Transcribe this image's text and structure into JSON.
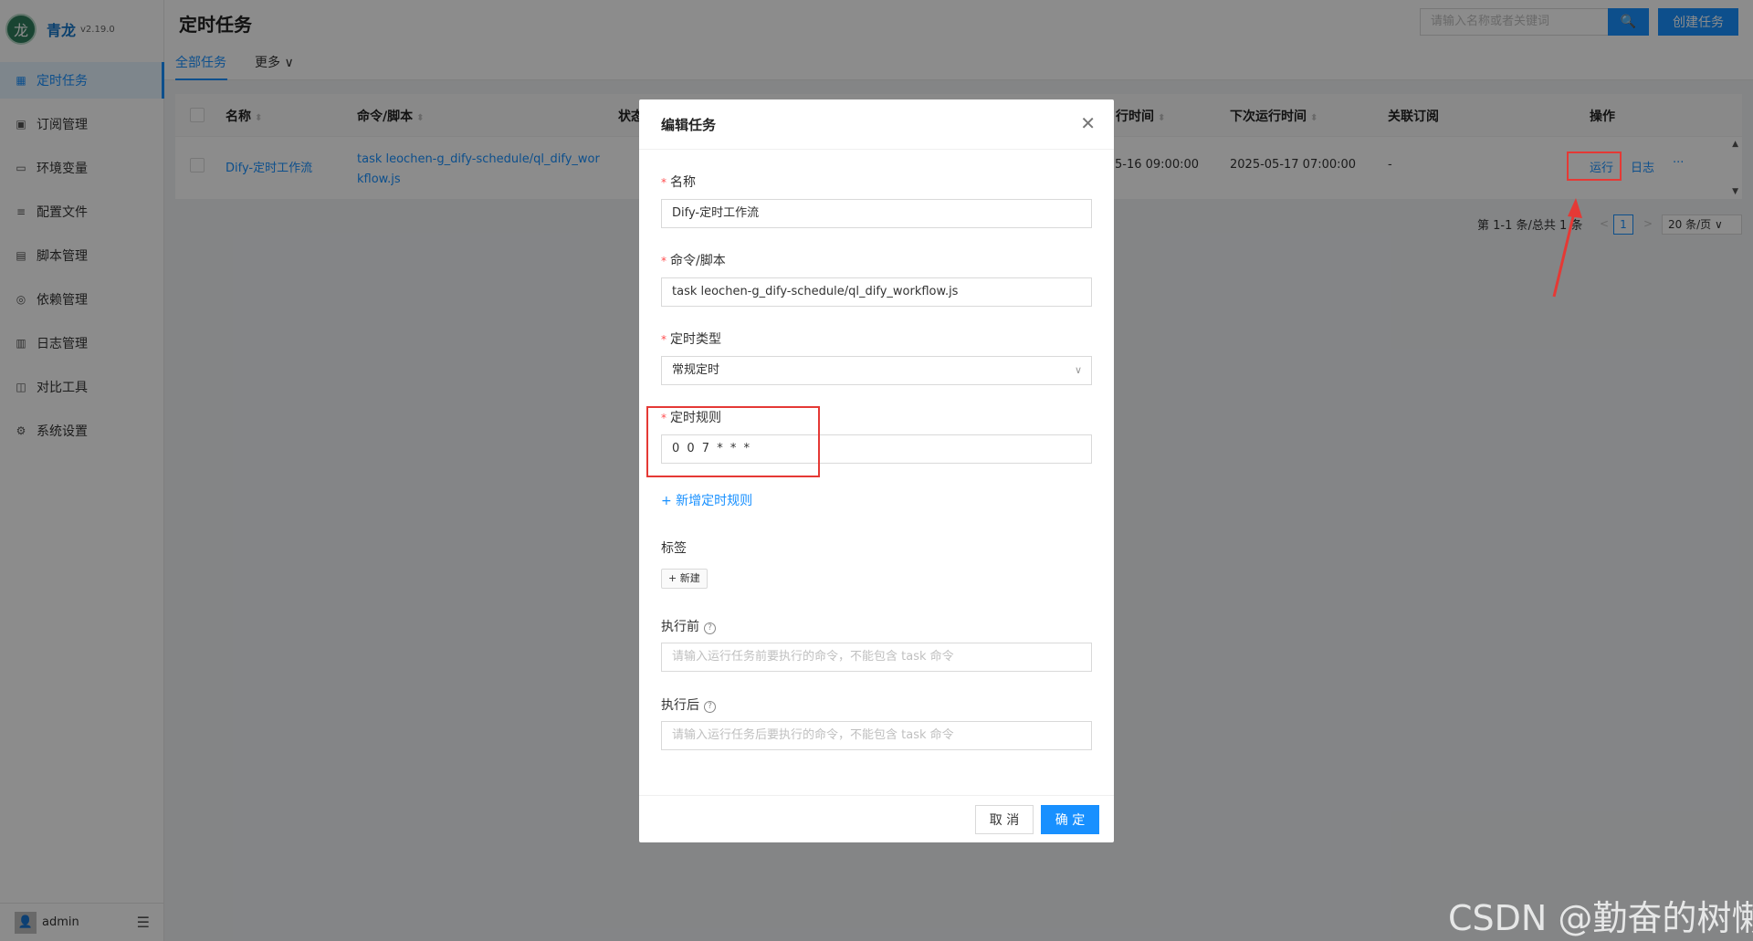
{
  "app": {
    "logo_char": "龙",
    "name": "青龙",
    "version": "v2.19.0"
  },
  "sidebar": {
    "items": [
      {
        "label": "定时任务",
        "icon": "calendar-icon",
        "glyph": "▦"
      },
      {
        "label": "订阅管理",
        "icon": "subscription-icon",
        "glyph": "▣"
      },
      {
        "label": "环境变量",
        "icon": "monitor-icon",
        "glyph": "▭"
      },
      {
        "label": "配置文件",
        "icon": "sliders-icon",
        "glyph": "≡"
      },
      {
        "label": "脚本管理",
        "icon": "code-icon",
        "glyph": "▤"
      },
      {
        "label": "依赖管理",
        "icon": "package-icon",
        "glyph": "◎"
      },
      {
        "label": "日志管理",
        "icon": "log-icon",
        "glyph": "▥"
      },
      {
        "label": "对比工具",
        "icon": "diff-icon",
        "glyph": "◫"
      },
      {
        "label": "系统设置",
        "icon": "gear-icon",
        "glyph": "⚙"
      }
    ],
    "user": "admin",
    "avatar_glyph": "👤",
    "collapse_glyph": "☰"
  },
  "header": {
    "title": "定时任务",
    "search_placeholder": "请输入名称或者关键词",
    "search_glyph": "🔍",
    "create_label": "创建任务"
  },
  "tabs": {
    "all": "全部任务",
    "more": "更多 ∨"
  },
  "table": {
    "columns": {
      "name": "名称",
      "command": "命令/脚本",
      "status": "状态",
      "last_run": "行时间",
      "next_run": "下次运行时间",
      "subscription": "关联订阅",
      "actions": "操作"
    },
    "sort_glyph": "⬍",
    "row": {
      "name": "Dify-定时工作流",
      "command_line1": "task leochen-g_dify-schedule/ql_dify_wor",
      "command_line2": "kflow.js",
      "last_run": "5-16 09:00:00",
      "next_run": "2025-05-17 07:00:00",
      "subscription": "-",
      "run": "运行",
      "log": "日志",
      "more": "···"
    }
  },
  "pagination": {
    "summary": "第 1-1 条/总共 1 条",
    "current": "1",
    "page_size": "20 条/页 ∨",
    "prev": "<",
    "next": ">"
  },
  "modal": {
    "title": "编辑任务",
    "close_glyph": "✕",
    "required_mark": "*",
    "name_label": "名称",
    "name_value": "Dify-定时工作流",
    "command_label": "命令/脚本",
    "command_value": "task leochen-g_dify-schedule/ql_dify_workflow.js",
    "type_label": "定时类型",
    "type_value": "常规定时",
    "rule_label": "定时规则",
    "rule_value": "0 0 7 * * *",
    "add_rule": "+ 新增定时规则",
    "tags_label": "标签",
    "new_tag": "+ 新建",
    "before_label": "执行前",
    "before_placeholder": "请输入运行任务前要执行的命令，不能包含 task 命令",
    "after_label": "执行后",
    "after_placeholder": "请输入运行任务后要执行的命令，不能包含 task 命令",
    "help_glyph": "?",
    "cancel": "取 消",
    "ok": "确 定"
  },
  "watermark": "CSDN @勤奋的树懒",
  "colors": {
    "primary": "#1890ff",
    "annotation": "#e53935"
  }
}
